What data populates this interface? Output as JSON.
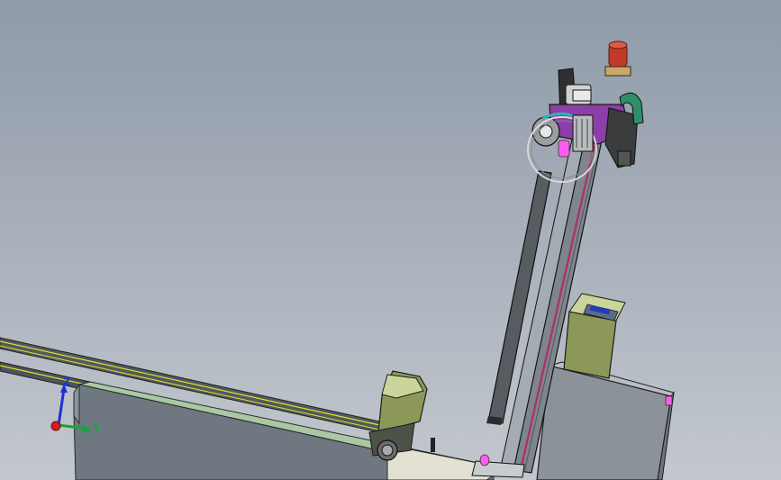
{
  "viewport": {
    "background_top": "#8f9aa8",
    "background_bottom": "#c3c8ce"
  },
  "triad": {
    "z_label": "Z",
    "y_label": "Y",
    "z_color": "#1f2fd6",
    "y_color": "#1aa33a",
    "x_color": "#d02020"
  },
  "model": {
    "highlight_color": "#ff5cf0",
    "purple_color": "#8c3fa6",
    "olive_color": "#8b9858",
    "green_rail_color": "#a9c8a4",
    "yellow_edge_color": "#e8e020",
    "warning_light_color": "#c0392b",
    "cable_color": "#2f8f6a"
  }
}
